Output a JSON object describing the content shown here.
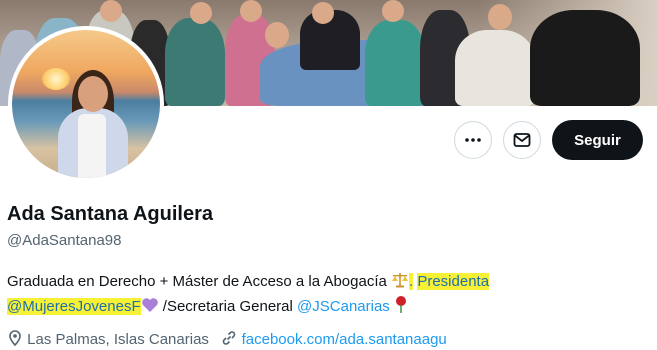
{
  "profile": {
    "name": "Ada Santana Aguilera",
    "handle": "@AdaSantana98",
    "bio_line1_text": "Graduada en Derecho + Máster de Acceso a la Abogacía",
    "bio_line1_sep": ".",
    "bio_line1_highlight": "Presidenta",
    "bio_line2_highlight": "@MujeresJovenesF",
    "bio_line2_text": "/Secretaria General",
    "bio_line2_link": "@JSCanarias",
    "location": "Las Palmas, Islas Canarias",
    "website": "facebook.com/ada.santanaagu"
  },
  "actions": {
    "follow_label": "Seguir"
  },
  "colors": {
    "highlight": "#f7f135",
    "link": "#1d9bf0",
    "follow_bg": "#0f1419"
  },
  "icons": [
    "more-icon",
    "mail-icon",
    "scales-icon",
    "purple-heart-icon",
    "rose-icon",
    "location-icon",
    "link-icon"
  ]
}
